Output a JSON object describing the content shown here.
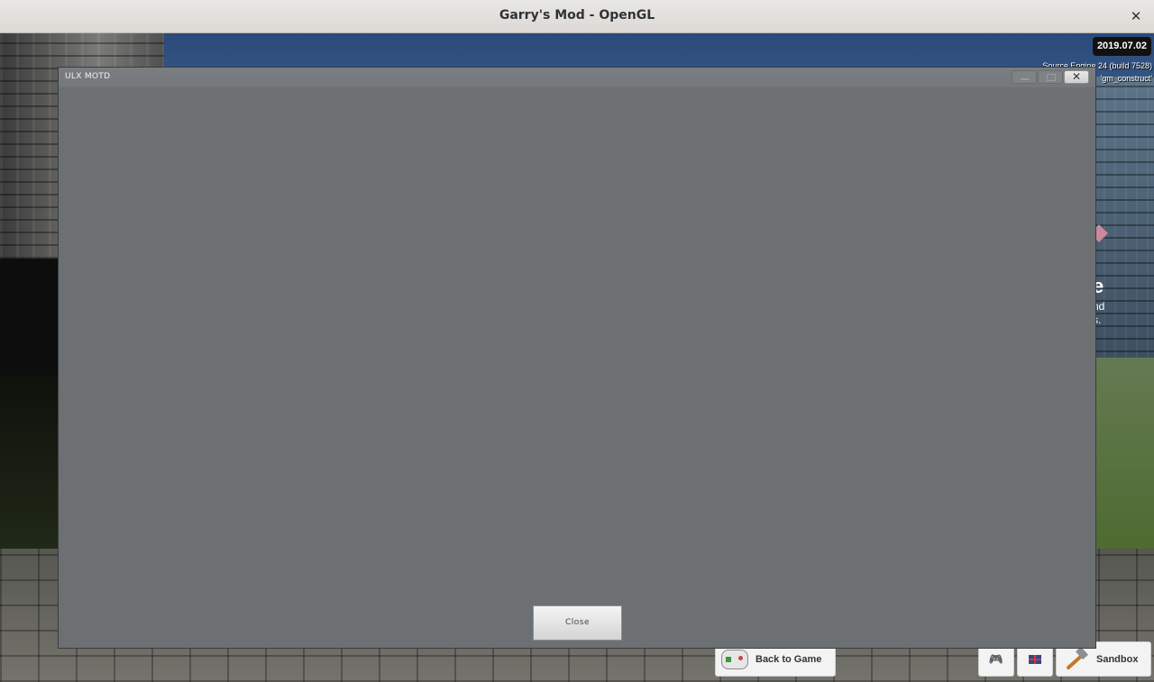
{
  "os_window": {
    "title": "Garry's Mod - OpenGL",
    "close_glyph": "✕"
  },
  "hud": {
    "date": "2019.07.02",
    "engine_line": "Source Engine 24 (build 7528)",
    "map_line": "'gm_construct'"
  },
  "menu_peek": {
    "title_fragment": "e",
    "line1": "nd",
    "line2": "s."
  },
  "motd": {
    "title": "ULX MOTD",
    "close_glyph": "✕",
    "close_button": "Close"
  },
  "bottom_bar": {
    "back_to_game": "Back to Game",
    "games_icon": "gamepad-icon",
    "language_icon": "uk-flag-icon",
    "gamemode": "Sandbox",
    "gamemode_icon": "hammer-icon"
  }
}
